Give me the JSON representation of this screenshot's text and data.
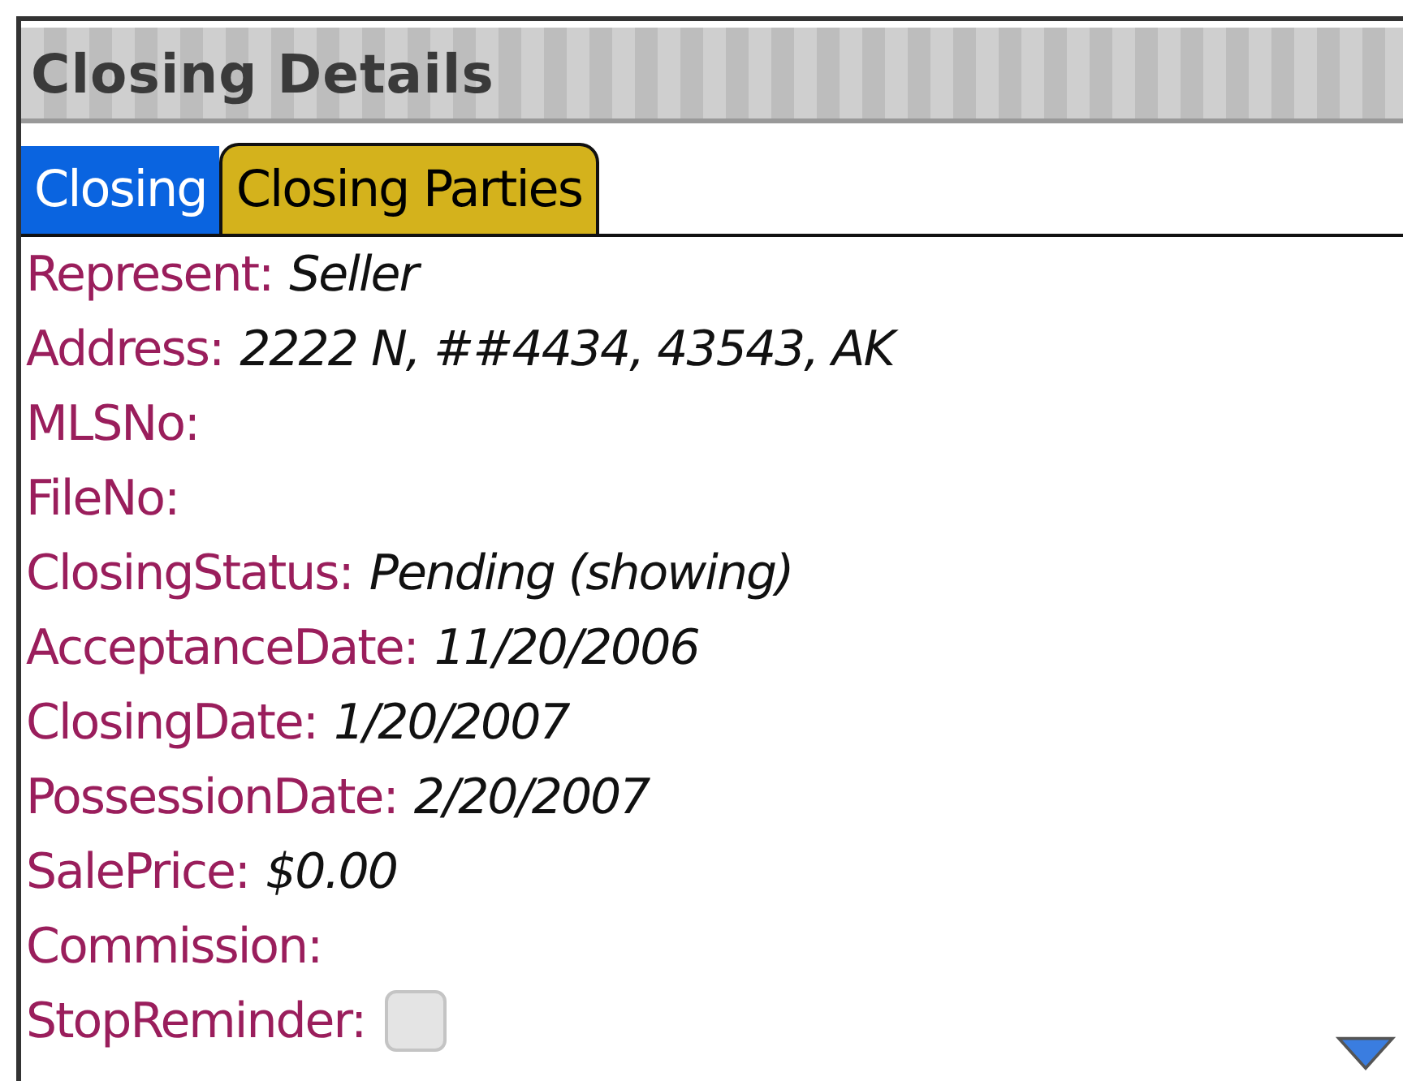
{
  "header": {
    "title": "Closing Details"
  },
  "tabs": [
    {
      "label": "Closing",
      "selected": true
    },
    {
      "label": "Closing Parties",
      "selected": false
    }
  ],
  "fields": [
    {
      "kind": "text",
      "label": "Represent:",
      "value": "Seller"
    },
    {
      "kind": "text",
      "label": "Address:",
      "value": "2222 N, ##4434, 43543, AK"
    },
    {
      "kind": "text",
      "label": "MLSNo:"
    },
    {
      "kind": "text",
      "label": "FileNo:"
    },
    {
      "kind": "text",
      "label": "ClosingStatus:",
      "value": "Pending (showing)"
    },
    {
      "kind": "text",
      "label": "AcceptanceDate:",
      "value": "11/20/2006"
    },
    {
      "kind": "text",
      "label": "ClosingDate:",
      "value": "1/20/2007"
    },
    {
      "kind": "text",
      "label": "PossessionDate:",
      "value": "2/20/2007"
    },
    {
      "kind": "text",
      "label": "SalePrice:",
      "value": "$0.00"
    },
    {
      "kind": "text",
      "label": "Commission:"
    },
    {
      "kind": "checkbox",
      "label": "StopReminder:",
      "checked": false
    }
  ]
}
